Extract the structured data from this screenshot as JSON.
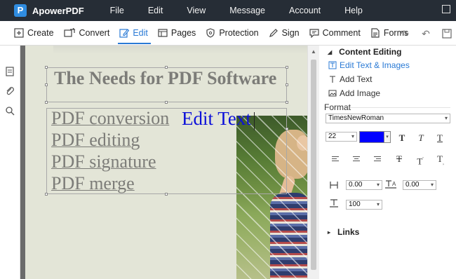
{
  "app": {
    "name": "ApowerPDF",
    "logo_letter": "P"
  },
  "menu": [
    "File",
    "Edit",
    "View",
    "Message",
    "Account",
    "Help"
  ],
  "toolbar": {
    "create": "Create",
    "convert": "Convert",
    "edit": "Edit",
    "pages": "Pages",
    "protection": "Protection",
    "sign": "Sign",
    "comment": "Comment",
    "forms": "Forms"
  },
  "document": {
    "title": "The Needs for PDF Software",
    "lines": [
      "PDF conversion",
      "PDF editing",
      "PDF signature",
      "PDF merge"
    ],
    "inserted_text": "Edit Text",
    "inserted_text_color": "#0000ff"
  },
  "panel": {
    "section_title": "Content Editing",
    "items": [
      "Edit Text & Images",
      "Add Text",
      "Add Image"
    ],
    "format_label": "Format",
    "font_family": "TimesNewRoman",
    "font_size": "22",
    "text_color": "#0000ff",
    "line_spacing": "0.00",
    "char_spacing": "0.00",
    "scale": "100",
    "links_label": "Links"
  },
  "colors": {
    "titlebar": "#262d36",
    "accent": "#2a7ad5",
    "page_background": "#e3e5d7"
  }
}
